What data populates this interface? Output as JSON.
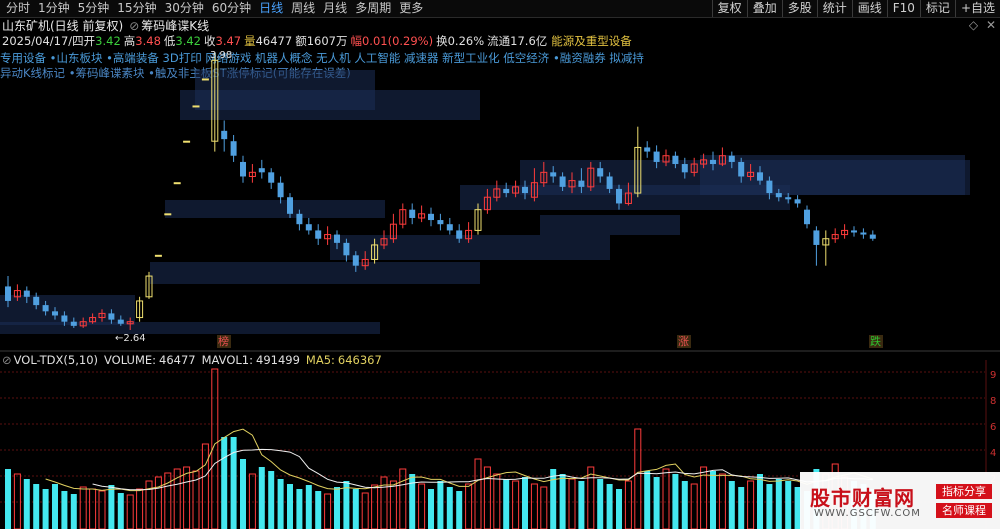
{
  "toolbar": {
    "tabs": [
      "分时",
      "1分钟",
      "5分钟",
      "15分钟",
      "30分钟",
      "60分钟",
      "日线",
      "周线",
      "月线",
      "多周期",
      "更多"
    ],
    "active_tab": "日线",
    "right_buttons": [
      "复权",
      "叠加",
      "多股",
      "统计",
      "画线",
      "F10",
      "标记",
      "+自选"
    ]
  },
  "title": {
    "stock": "山东矿机(日线 前复权)",
    "chip_label": "筹码峰谍K线"
  },
  "quote": {
    "date": "2025/04/17/四",
    "open_label": "开",
    "open": "3.42",
    "high_label": "高",
    "high": "3.48",
    "low_label": "低",
    "low": "3.42",
    "close_label": "收",
    "close": "3.47",
    "vol_label": "量",
    "vol": "46477",
    "amount_label": "额",
    "amount": "1607万",
    "chg_label": "幅",
    "chg": "0.01(0.29%)",
    "turnover_label": "换",
    "turnover": "0.26%",
    "float_label": "流通",
    "float": "17.6亿",
    "sector": "能源及重型设备"
  },
  "tags_line1": "专用设备 •山东板块 •高端装备 3D打印 网络游戏 机器人概念 无人机 人工智能 减速器 新型工业化 低空经济 •融资融券 拟减持",
  "tags_line2": "异动K线标记 •筹码峰谍素块 •触及非主板ST涨停标记(可能存在误差)",
  "chart_annotations": {
    "low_label": "←2.64",
    "peak_label": "3.98",
    "markers": [
      "榜",
      "涨",
      "跌"
    ],
    "marker_colors": [
      "#e85050",
      "#e85050",
      "#2ec22e"
    ]
  },
  "volume": {
    "indicator": "VOL-TDX(5,10)",
    "volume_label": "VOLUME:",
    "volume_value": "46477",
    "mavol1_label": "MAVOL1:",
    "mavol1_value": "491499",
    "ma5_label": "MA5:",
    "ma5_value": "646367",
    "axis_ticks": [
      "9",
      "8",
      "6",
      "4",
      "2"
    ]
  },
  "watermark": {
    "site": "股市财富网",
    "url": "WWW.GSCFW.COM",
    "badge1": "指标分享",
    "badge2": "名师课程"
  },
  "colors": {
    "up": "#ff3c3c",
    "down": "#50a0e0",
    "doji_up": "#f0e070",
    "chip": "#1a2a4a",
    "vol_up": "#ff3c3c",
    "vol_down": "#44e8f0",
    "ma_yellow": "#e0d060",
    "ma_white": "#f0f0f0",
    "active_tab": "#4aa3ff"
  }
}
